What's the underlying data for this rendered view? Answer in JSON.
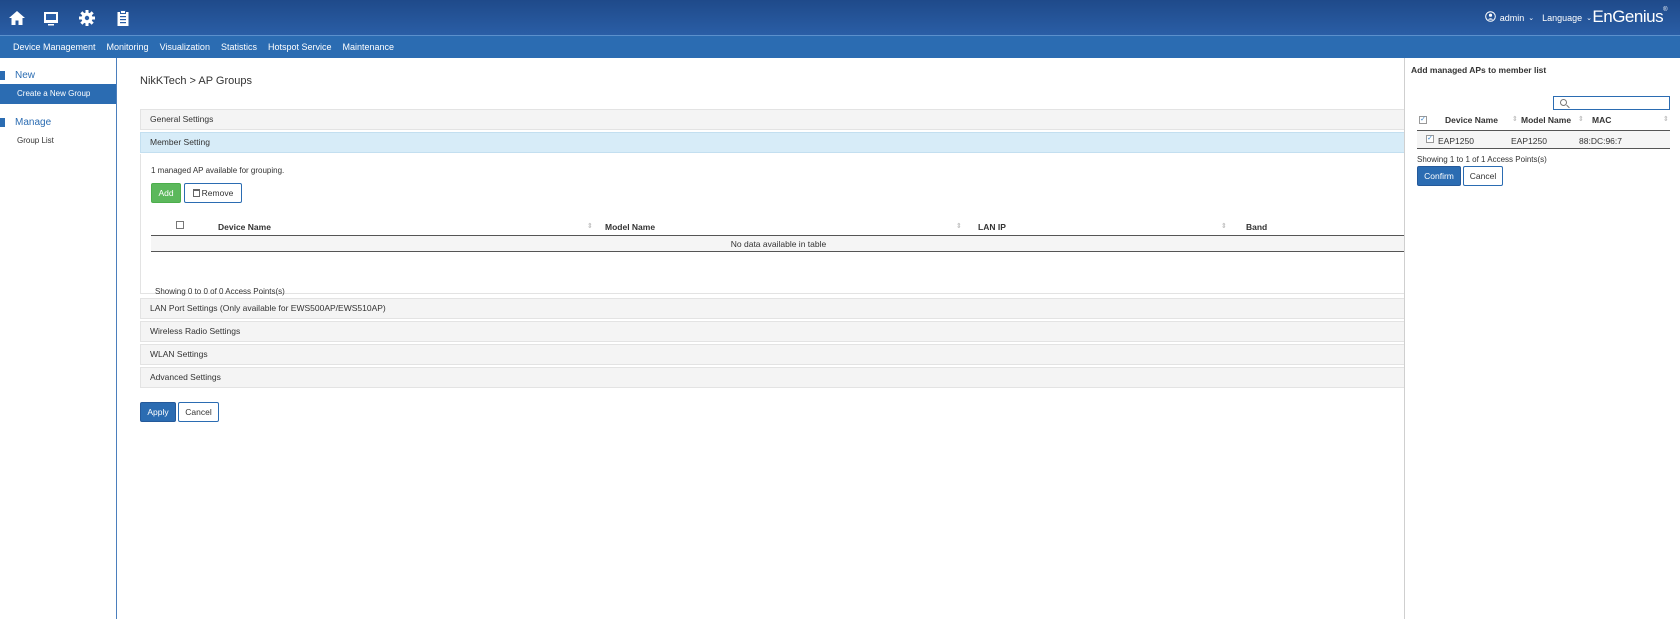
{
  "header": {
    "icons": [
      "home-icon",
      "monitor-icon",
      "gear-icon",
      "clipboard-icon"
    ],
    "user": "admin",
    "language": "Language",
    "brand": "EnGenius",
    "brand_mark": "®"
  },
  "nav": {
    "items": [
      "Device Management",
      "Monitoring",
      "Visualization",
      "Statistics",
      "Hotspot Service",
      "Maintenance"
    ]
  },
  "sidebar": {
    "sections": [
      {
        "title": "New",
        "items": [
          {
            "label": "Create a New Group",
            "active": true
          }
        ]
      },
      {
        "title": "Manage",
        "items": [
          {
            "label": "Group List",
            "active": false
          }
        ]
      }
    ]
  },
  "main": {
    "breadcrumb": "NikKTech > AP Groups",
    "accordion": {
      "general": "General Settings",
      "member": "Member Setting",
      "lan_port": "LAN Port Settings (Only available for EWS500AP/EWS510AP)",
      "wireless": "Wireless Radio Settings",
      "wlan": "WLAN Settings",
      "advanced": "Advanced Settings"
    },
    "member": {
      "available_text": "1 managed AP available for grouping.",
      "add_label": "Add",
      "remove_label": "Remove",
      "columns": [
        "Device Name",
        "Model Name",
        "LAN IP",
        "Band"
      ],
      "empty_text": "No data available in table",
      "showing": "Showing 0 to 0 of 0 Access Points(s)"
    },
    "apply_label": "Apply",
    "cancel_label": "Cancel"
  },
  "panel": {
    "title": "Add managed APs to member list",
    "search_value": "",
    "columns": [
      "Device Name",
      "Model Name",
      "MAC"
    ],
    "rows": [
      {
        "device_name": "EAP1250",
        "model_name": "EAP1250",
        "mac": "88:DC:96:7",
        "checked": true
      }
    ],
    "showing": "Showing 1 to 1 of 1 Access Points(s)",
    "confirm_label": "Confirm",
    "cancel_label": "Cancel"
  }
}
